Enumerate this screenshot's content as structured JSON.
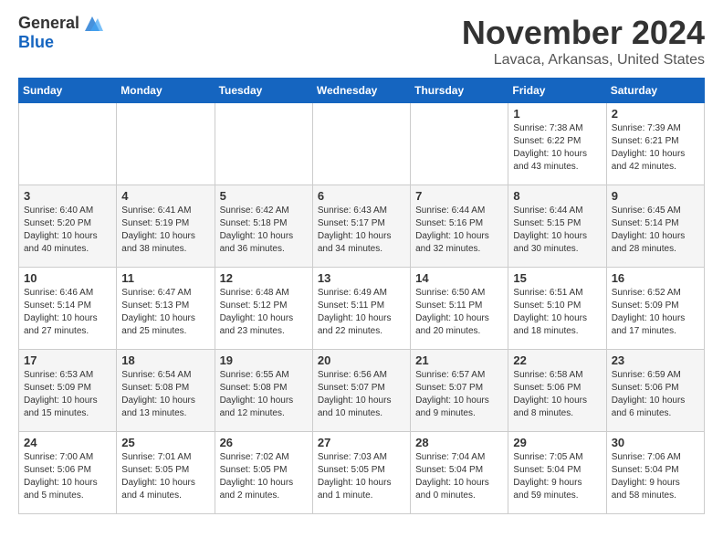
{
  "header": {
    "logo": {
      "general": "General",
      "blue": "Blue"
    },
    "title": "November 2024",
    "location": "Lavaca, Arkansas, United States"
  },
  "weekdays": [
    "Sunday",
    "Monday",
    "Tuesday",
    "Wednesday",
    "Thursday",
    "Friday",
    "Saturday"
  ],
  "weeks": [
    [
      {
        "day": "",
        "info": ""
      },
      {
        "day": "",
        "info": ""
      },
      {
        "day": "",
        "info": ""
      },
      {
        "day": "",
        "info": ""
      },
      {
        "day": "",
        "info": ""
      },
      {
        "day": "1",
        "info": "Sunrise: 7:38 AM\nSunset: 6:22 PM\nDaylight: 10 hours\nand 43 minutes."
      },
      {
        "day": "2",
        "info": "Sunrise: 7:39 AM\nSunset: 6:21 PM\nDaylight: 10 hours\nand 42 minutes."
      }
    ],
    [
      {
        "day": "3",
        "info": "Sunrise: 6:40 AM\nSunset: 5:20 PM\nDaylight: 10 hours\nand 40 minutes."
      },
      {
        "day": "4",
        "info": "Sunrise: 6:41 AM\nSunset: 5:19 PM\nDaylight: 10 hours\nand 38 minutes."
      },
      {
        "day": "5",
        "info": "Sunrise: 6:42 AM\nSunset: 5:18 PM\nDaylight: 10 hours\nand 36 minutes."
      },
      {
        "day": "6",
        "info": "Sunrise: 6:43 AM\nSunset: 5:17 PM\nDaylight: 10 hours\nand 34 minutes."
      },
      {
        "day": "7",
        "info": "Sunrise: 6:44 AM\nSunset: 5:16 PM\nDaylight: 10 hours\nand 32 minutes."
      },
      {
        "day": "8",
        "info": "Sunrise: 6:44 AM\nSunset: 5:15 PM\nDaylight: 10 hours\nand 30 minutes."
      },
      {
        "day": "9",
        "info": "Sunrise: 6:45 AM\nSunset: 5:14 PM\nDaylight: 10 hours\nand 28 minutes."
      }
    ],
    [
      {
        "day": "10",
        "info": "Sunrise: 6:46 AM\nSunset: 5:14 PM\nDaylight: 10 hours\nand 27 minutes."
      },
      {
        "day": "11",
        "info": "Sunrise: 6:47 AM\nSunset: 5:13 PM\nDaylight: 10 hours\nand 25 minutes."
      },
      {
        "day": "12",
        "info": "Sunrise: 6:48 AM\nSunset: 5:12 PM\nDaylight: 10 hours\nand 23 minutes."
      },
      {
        "day": "13",
        "info": "Sunrise: 6:49 AM\nSunset: 5:11 PM\nDaylight: 10 hours\nand 22 minutes."
      },
      {
        "day": "14",
        "info": "Sunrise: 6:50 AM\nSunset: 5:11 PM\nDaylight: 10 hours\nand 20 minutes."
      },
      {
        "day": "15",
        "info": "Sunrise: 6:51 AM\nSunset: 5:10 PM\nDaylight: 10 hours\nand 18 minutes."
      },
      {
        "day": "16",
        "info": "Sunrise: 6:52 AM\nSunset: 5:09 PM\nDaylight: 10 hours\nand 17 minutes."
      }
    ],
    [
      {
        "day": "17",
        "info": "Sunrise: 6:53 AM\nSunset: 5:09 PM\nDaylight: 10 hours\nand 15 minutes."
      },
      {
        "day": "18",
        "info": "Sunrise: 6:54 AM\nSunset: 5:08 PM\nDaylight: 10 hours\nand 13 minutes."
      },
      {
        "day": "19",
        "info": "Sunrise: 6:55 AM\nSunset: 5:08 PM\nDaylight: 10 hours\nand 12 minutes."
      },
      {
        "day": "20",
        "info": "Sunrise: 6:56 AM\nSunset: 5:07 PM\nDaylight: 10 hours\nand 10 minutes."
      },
      {
        "day": "21",
        "info": "Sunrise: 6:57 AM\nSunset: 5:07 PM\nDaylight: 10 hours\nand 9 minutes."
      },
      {
        "day": "22",
        "info": "Sunrise: 6:58 AM\nSunset: 5:06 PM\nDaylight: 10 hours\nand 8 minutes."
      },
      {
        "day": "23",
        "info": "Sunrise: 6:59 AM\nSunset: 5:06 PM\nDaylight: 10 hours\nand 6 minutes."
      }
    ],
    [
      {
        "day": "24",
        "info": "Sunrise: 7:00 AM\nSunset: 5:06 PM\nDaylight: 10 hours\nand 5 minutes."
      },
      {
        "day": "25",
        "info": "Sunrise: 7:01 AM\nSunset: 5:05 PM\nDaylight: 10 hours\nand 4 minutes."
      },
      {
        "day": "26",
        "info": "Sunrise: 7:02 AM\nSunset: 5:05 PM\nDaylight: 10 hours\nand 2 minutes."
      },
      {
        "day": "27",
        "info": "Sunrise: 7:03 AM\nSunset: 5:05 PM\nDaylight: 10 hours\nand 1 minute."
      },
      {
        "day": "28",
        "info": "Sunrise: 7:04 AM\nSunset: 5:04 PM\nDaylight: 10 hours\nand 0 minutes."
      },
      {
        "day": "29",
        "info": "Sunrise: 7:05 AM\nSunset: 5:04 PM\nDaylight: 9 hours\nand 59 minutes."
      },
      {
        "day": "30",
        "info": "Sunrise: 7:06 AM\nSunset: 5:04 PM\nDaylight: 9 hours\nand 58 minutes."
      }
    ]
  ]
}
